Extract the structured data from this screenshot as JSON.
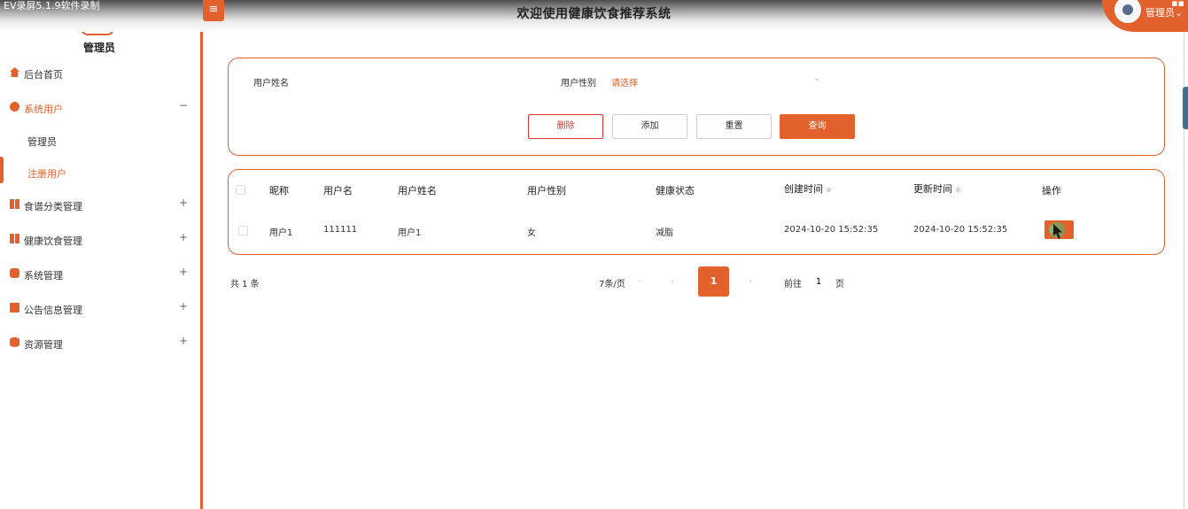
{
  "recorder_text": "EV录屏5.1.9软件录制",
  "header": {
    "title": "欢迎使用健康饮食推荐系统",
    "toggle_icon": "≡",
    "user_name": "管理员",
    "user_chevron": "⌄",
    "corner_glyph": "▪▪"
  },
  "sidebar": {
    "role_label": "管理员",
    "items": [
      {
        "label": "后台首页",
        "icon": "house-icon",
        "sign": ""
      },
      {
        "label": "系统用户",
        "icon": "user-circle-icon",
        "sign": "−"
      },
      {
        "label": "食谱分类管理",
        "icon": "grid-icon",
        "sign": "+"
      },
      {
        "label": "健康饮食管理",
        "icon": "grid-icon",
        "sign": "+"
      },
      {
        "label": "系统管理",
        "icon": "gear-icon",
        "sign": "+"
      },
      {
        "label": "公告信息管理",
        "icon": "document-icon",
        "sign": "+"
      },
      {
        "label": "资源管理",
        "icon": "database-icon",
        "sign": "+"
      }
    ],
    "sub_items": [
      {
        "label": "管理员"
      },
      {
        "label": "注册用户"
      }
    ]
  },
  "search": {
    "name_label": "用户姓名",
    "name_value": "",
    "gender_label": "用户性别",
    "gender_placeholder": "请选择",
    "buttons": {
      "delete": "删除",
      "add": "添加",
      "reset": "重置",
      "query": "查询"
    }
  },
  "table": {
    "columns": [
      "昵称",
      "用户名",
      "用户姓名",
      "用户性别",
      "健康状态",
      "创建时间",
      "更新时间",
      "操作"
    ],
    "sort_glyph": "≑",
    "rows": [
      {
        "nickname": "用户1",
        "username": "111111",
        "real_name": "用户1",
        "gender": "女",
        "health_status": "减脂",
        "created": "2024-10-20 15:52:35",
        "updated": "2024-10-20 15:52:35",
        "action_label": "详"
      }
    ]
  },
  "pagination": {
    "total_text": "共 1 条",
    "page_size": "7条/页",
    "current_page": "1",
    "goto_label": "前往",
    "goto_value": "1",
    "page_unit": "页",
    "prev": "‹",
    "next": "›",
    "chevron": "⌄"
  },
  "colors": {
    "accent": "#e2612d",
    "danger": "#e03030"
  }
}
